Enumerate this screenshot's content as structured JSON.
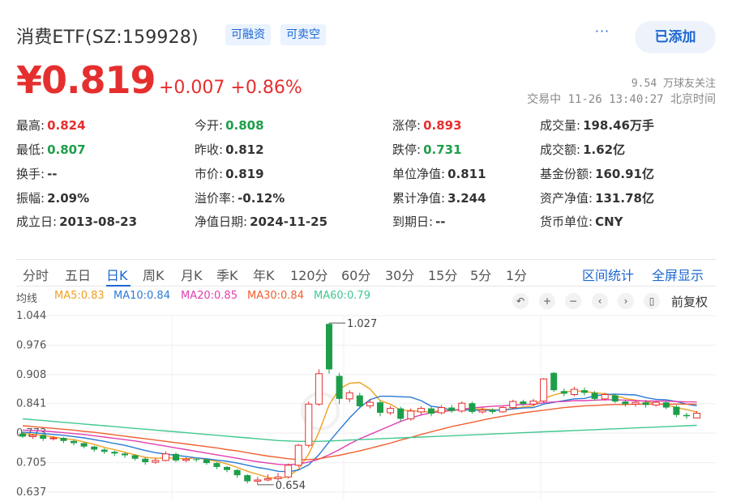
{
  "header": {
    "title": "消费ETF(SZ:159928)",
    "tags": [
      "可融资",
      "可卖空"
    ],
    "more": "···",
    "add_button": "已添加"
  },
  "price": {
    "current": "¥0.819",
    "change": "+0.007 +0.86%",
    "followers": "9.54 万球友关注",
    "status": "交易中 11-26 13:40:27 北京时间"
  },
  "quote": [
    [
      {
        "label": "最高:",
        "value": "0.824",
        "tone": "up"
      },
      {
        "label": "今开:",
        "value": "0.808",
        "tone": "down"
      },
      {
        "label": "涨停:",
        "value": "0.893",
        "tone": "up"
      },
      {
        "label": "成交量:",
        "value": "198.46万手",
        "tone": "neutral"
      }
    ],
    [
      {
        "label": "最低:",
        "value": "0.807",
        "tone": "down"
      },
      {
        "label": "昨收:",
        "value": "0.812",
        "tone": "neutral"
      },
      {
        "label": "跌停:",
        "value": "0.731",
        "tone": "down"
      },
      {
        "label": "成交额:",
        "value": "1.62亿",
        "tone": "neutral"
      }
    ],
    [
      {
        "label": "换手:",
        "value": "--",
        "tone": "neutral"
      },
      {
        "label": "市价:",
        "value": "0.819",
        "tone": "neutral"
      },
      {
        "label": "单位净值:",
        "value": "0.811",
        "tone": "neutral"
      },
      {
        "label": "基金份额:",
        "value": "160.91亿",
        "tone": "neutral"
      }
    ],
    [
      {
        "label": "振幅:",
        "value": "2.09%",
        "tone": "neutral"
      },
      {
        "label": "溢价率:",
        "value": "-0.12%",
        "tone": "neutral"
      },
      {
        "label": "累计净值:",
        "value": "3.244",
        "tone": "neutral"
      },
      {
        "label": "资产净值:",
        "value": "131.78亿",
        "tone": "neutral"
      }
    ],
    [
      {
        "label": "成立日:",
        "value": "2013-08-23",
        "tone": "neutral"
      },
      {
        "label": "净值日期:",
        "value": "2024-11-25",
        "tone": "neutral"
      },
      {
        "label": "到期日:",
        "value": "--",
        "tone": "neutral"
      },
      {
        "label": "货币单位:",
        "value": "CNY",
        "tone": "neutral"
      }
    ]
  ],
  "tabs": [
    "分时",
    "五日",
    "日K",
    "周K",
    "月K",
    "季K",
    "年K",
    "120分",
    "60分",
    "30分",
    "15分",
    "5分",
    "1分"
  ],
  "active_tab": "日K",
  "tab_actions": [
    "区间统计",
    "全屏显示"
  ],
  "ma_legend": [
    {
      "label": "均线",
      "color": "#555555"
    },
    {
      "label": "MA5:0.83",
      "color": "#f0a020"
    },
    {
      "label": "MA10:0.84",
      "color": "#2a7bd5"
    },
    {
      "label": "MA20:0.85",
      "color": "#e040b0"
    },
    {
      "label": "MA30:0.84",
      "color": "#f06030"
    },
    {
      "label": "MA60:0.79",
      "color": "#40c890"
    }
  ],
  "chart_controls": [
    "↶",
    "+",
    "−",
    "‹",
    "›",
    "▯"
  ],
  "fuquan": "前复权",
  "colors": {
    "up": "#e52f2f",
    "down": "#1e9e4a",
    "accent": "#1b66d2"
  },
  "chart_data": {
    "type": "candlestick",
    "y_ticks": [
      "1.044",
      "0.976",
      "0.908",
      "0.841",
      "0.773",
      "0.705",
      "0.637"
    ],
    "ylim": [
      0.637,
      1.044
    ],
    "annotations": [
      {
        "label": "1.027",
        "index": 30,
        "value": 1.027
      },
      {
        "label": "0.654",
        "index": 23,
        "value": 0.654
      }
    ],
    "candles": [
      {
        "o": 0.772,
        "c": 0.765,
        "h": 0.776,
        "l": 0.762
      },
      {
        "o": 0.765,
        "c": 0.768,
        "h": 0.771,
        "l": 0.76
      },
      {
        "o": 0.768,
        "c": 0.76,
        "h": 0.77,
        "l": 0.755
      },
      {
        "o": 0.76,
        "c": 0.762,
        "h": 0.766,
        "l": 0.756
      },
      {
        "o": 0.762,
        "c": 0.755,
        "h": 0.764,
        "l": 0.75
      },
      {
        "o": 0.755,
        "c": 0.75,
        "h": 0.758,
        "l": 0.745
      },
      {
        "o": 0.75,
        "c": 0.742,
        "h": 0.752,
        "l": 0.738
      },
      {
        "o": 0.742,
        "c": 0.735,
        "h": 0.744,
        "l": 0.73
      },
      {
        "o": 0.735,
        "c": 0.73,
        "h": 0.738,
        "l": 0.725
      },
      {
        "o": 0.73,
        "c": 0.726,
        "h": 0.733,
        "l": 0.72
      },
      {
        "o": 0.726,
        "c": 0.722,
        "h": 0.728,
        "l": 0.716
      },
      {
        "o": 0.722,
        "c": 0.714,
        "h": 0.724,
        "l": 0.71
      },
      {
        "o": 0.714,
        "c": 0.706,
        "h": 0.718,
        "l": 0.7
      },
      {
        "o": 0.706,
        "c": 0.71,
        "h": 0.716,
        "l": 0.702
      },
      {
        "o": 0.71,
        "c": 0.725,
        "h": 0.731,
        "l": 0.708
      },
      {
        "o": 0.725,
        "c": 0.71,
        "h": 0.728,
        "l": 0.706
      },
      {
        "o": 0.71,
        "c": 0.713,
        "h": 0.717,
        "l": 0.706
      },
      {
        "o": 0.713,
        "c": 0.712,
        "h": 0.716,
        "l": 0.707
      },
      {
        "o": 0.712,
        "c": 0.704,
        "h": 0.714,
        "l": 0.7
      },
      {
        "o": 0.704,
        "c": 0.695,
        "h": 0.706,
        "l": 0.69
      },
      {
        "o": 0.695,
        "c": 0.688,
        "h": 0.697,
        "l": 0.683
      },
      {
        "o": 0.688,
        "c": 0.676,
        "h": 0.69,
        "l": 0.67
      },
      {
        "o": 0.676,
        "c": 0.662,
        "h": 0.678,
        "l": 0.657
      },
      {
        "o": 0.662,
        "c": 0.665,
        "h": 0.672,
        "l": 0.654
      },
      {
        "o": 0.665,
        "c": 0.668,
        "h": 0.678,
        "l": 0.662
      },
      {
        "o": 0.668,
        "c": 0.672,
        "h": 0.681,
        "l": 0.664
      },
      {
        "o": 0.672,
        "c": 0.699,
        "h": 0.703,
        "l": 0.668
      },
      {
        "o": 0.699,
        "c": 0.745,
        "h": 0.748,
        "l": 0.695
      },
      {
        "o": 0.745,
        "c": 0.84,
        "h": 0.846,
        "l": 0.74
      },
      {
        "o": 0.84,
        "c": 0.91,
        "h": 0.92,
        "l": 0.836
      },
      {
        "o": 1.025,
        "c": 0.92,
        "h": 1.027,
        "l": 0.91
      },
      {
        "o": 0.905,
        "c": 0.852,
        "h": 0.912,
        "l": 0.84
      },
      {
        "o": 0.852,
        "c": 0.866,
        "h": 0.872,
        "l": 0.844
      },
      {
        "o": 0.86,
        "c": 0.835,
        "h": 0.866,
        "l": 0.83
      },
      {
        "o": 0.836,
        "c": 0.844,
        "h": 0.852,
        "l": 0.83
      },
      {
        "o": 0.844,
        "c": 0.82,
        "h": 0.848,
        "l": 0.812
      },
      {
        "o": 0.82,
        "c": 0.83,
        "h": 0.836,
        "l": 0.815
      },
      {
        "o": 0.83,
        "c": 0.806,
        "h": 0.834,
        "l": 0.8
      },
      {
        "o": 0.806,
        "c": 0.824,
        "h": 0.83,
        "l": 0.802
      },
      {
        "o": 0.822,
        "c": 0.83,
        "h": 0.835,
        "l": 0.815
      },
      {
        "o": 0.83,
        "c": 0.818,
        "h": 0.834,
        "l": 0.812
      },
      {
        "o": 0.82,
        "c": 0.832,
        "h": 0.838,
        "l": 0.816
      },
      {
        "o": 0.832,
        "c": 0.824,
        "h": 0.838,
        "l": 0.82
      },
      {
        "o": 0.824,
        "c": 0.842,
        "h": 0.846,
        "l": 0.82
      },
      {
        "o": 0.842,
        "c": 0.822,
        "h": 0.846,
        "l": 0.818
      },
      {
        "o": 0.822,
        "c": 0.826,
        "h": 0.832,
        "l": 0.818
      },
      {
        "o": 0.826,
        "c": 0.822,
        "h": 0.83,
        "l": 0.818
      },
      {
        "o": 0.822,
        "c": 0.832,
        "h": 0.836,
        "l": 0.82
      },
      {
        "o": 0.832,
        "c": 0.846,
        "h": 0.85,
        "l": 0.828
      },
      {
        "o": 0.846,
        "c": 0.84,
        "h": 0.85,
        "l": 0.836
      },
      {
        "o": 0.84,
        "c": 0.847,
        "h": 0.852,
        "l": 0.836
      },
      {
        "o": 0.847,
        "c": 0.898,
        "h": 0.9,
        "l": 0.844
      },
      {
        "o": 0.912,
        "c": 0.872,
        "h": 0.914,
        "l": 0.868
      },
      {
        "o": 0.87,
        "c": 0.864,
        "h": 0.876,
        "l": 0.858
      },
      {
        "o": 0.862,
        "c": 0.874,
        "h": 0.88,
        "l": 0.858
      },
      {
        "o": 0.872,
        "c": 0.866,
        "h": 0.878,
        "l": 0.86
      },
      {
        "o": 0.866,
        "c": 0.852,
        "h": 0.87,
        "l": 0.848
      },
      {
        "o": 0.852,
        "c": 0.862,
        "h": 0.866,
        "l": 0.848
      },
      {
        "o": 0.86,
        "c": 0.846,
        "h": 0.864,
        "l": 0.842
      },
      {
        "o": 0.846,
        "c": 0.84,
        "h": 0.85,
        "l": 0.834
      },
      {
        "o": 0.84,
        "c": 0.844,
        "h": 0.848,
        "l": 0.834
      },
      {
        "o": 0.844,
        "c": 0.838,
        "h": 0.85,
        "l": 0.832
      },
      {
        "o": 0.838,
        "c": 0.844,
        "h": 0.848,
        "l": 0.834
      },
      {
        "o": 0.844,
        "c": 0.832,
        "h": 0.846,
        "l": 0.828
      },
      {
        "o": 0.834,
        "c": 0.815,
        "h": 0.838,
        "l": 0.81
      },
      {
        "o": 0.815,
        "c": 0.812,
        "h": 0.82,
        "l": 0.806
      },
      {
        "o": 0.808,
        "c": 0.819,
        "h": 0.824,
        "l": 0.807
      }
    ],
    "ma_series": [
      {
        "name": "MA5",
        "color": "#f0a020",
        "values": [
          0.772,
          0.77,
          0.768,
          0.764,
          0.76,
          0.758,
          0.753,
          0.747,
          0.74,
          0.735,
          0.729,
          0.723,
          0.717,
          0.715,
          0.716,
          0.715,
          0.714,
          0.716,
          0.712,
          0.708,
          0.702,
          0.694,
          0.685,
          0.678,
          0.671,
          0.668,
          0.673,
          0.69,
          0.725,
          0.775,
          0.838,
          0.875,
          0.888,
          0.89,
          0.875,
          0.848,
          0.84,
          0.826,
          0.825,
          0.823,
          0.822,
          0.826,
          0.825,
          0.829,
          0.828,
          0.829,
          0.827,
          0.826,
          0.83,
          0.833,
          0.836,
          0.853,
          0.861,
          0.867,
          0.871,
          0.869,
          0.866,
          0.864,
          0.86,
          0.853,
          0.849,
          0.846,
          0.841,
          0.839,
          0.832,
          0.827,
          0.822
        ]
      },
      {
        "name": "MA10",
        "color": "#2a7bd5",
        "values": [
          0.775,
          0.774,
          0.772,
          0.77,
          0.768,
          0.765,
          0.762,
          0.758,
          0.754,
          0.749,
          0.745,
          0.739,
          0.733,
          0.728,
          0.725,
          0.722,
          0.719,
          0.716,
          0.714,
          0.711,
          0.708,
          0.704,
          0.699,
          0.694,
          0.69,
          0.685,
          0.684,
          0.688,
          0.7,
          0.723,
          0.753,
          0.781,
          0.808,
          0.832,
          0.85,
          0.858,
          0.858,
          0.857,
          0.856,
          0.848,
          0.835,
          0.832,
          0.826,
          0.827,
          0.826,
          0.826,
          0.826,
          0.826,
          0.829,
          0.831,
          0.832,
          0.84,
          0.844,
          0.848,
          0.852,
          0.853,
          0.859,
          0.862,
          0.863,
          0.862,
          0.861,
          0.855,
          0.851,
          0.85,
          0.846,
          0.84,
          0.836
        ]
      },
      {
        "name": "MA20",
        "color": "#e040b0",
        "values": [
          0.78,
          0.779,
          0.778,
          0.776,
          0.774,
          0.772,
          0.77,
          0.767,
          0.764,
          0.761,
          0.758,
          0.755,
          0.751,
          0.747,
          0.743,
          0.739,
          0.735,
          0.731,
          0.727,
          0.723,
          0.719,
          0.715,
          0.711,
          0.707,
          0.704,
          0.701,
          0.7,
          0.702,
          0.706,
          0.713,
          0.723,
          0.735,
          0.748,
          0.76,
          0.77,
          0.78,
          0.79,
          0.8,
          0.808,
          0.815,
          0.82,
          0.823,
          0.825,
          0.828,
          0.831,
          0.833,
          0.835,
          0.836,
          0.838,
          0.839,
          0.84,
          0.843,
          0.845,
          0.846,
          0.848,
          0.848,
          0.849,
          0.85,
          0.85,
          0.849,
          0.848,
          0.847,
          0.847,
          0.847,
          0.846,
          0.845,
          0.845
        ]
      },
      {
        "name": "MA30",
        "color": "#f06030",
        "values": [
          0.79,
          0.788,
          0.786,
          0.784,
          0.782,
          0.78,
          0.777,
          0.775,
          0.772,
          0.769,
          0.766,
          0.763,
          0.76,
          0.757,
          0.754,
          0.751,
          0.748,
          0.745,
          0.742,
          0.739,
          0.735,
          0.732,
          0.728,
          0.724,
          0.72,
          0.717,
          0.714,
          0.712,
          0.712,
          0.714,
          0.718,
          0.722,
          0.727,
          0.732,
          0.738,
          0.744,
          0.75,
          0.757,
          0.763,
          0.77,
          0.776,
          0.782,
          0.788,
          0.793,
          0.798,
          0.803,
          0.808,
          0.812,
          0.816,
          0.82,
          0.823,
          0.826,
          0.829,
          0.832,
          0.834,
          0.836,
          0.837,
          0.838,
          0.839,
          0.839,
          0.84,
          0.84,
          0.84,
          0.84,
          0.84,
          0.84,
          0.84
        ]
      },
      {
        "name": "MA60",
        "color": "#40c890",
        "values": [
          0.806,
          0.804,
          0.802,
          0.8,
          0.798,
          0.796,
          0.794,
          0.792,
          0.79,
          0.788,
          0.786,
          0.784,
          0.782,
          0.78,
          0.778,
          0.776,
          0.774,
          0.772,
          0.77,
          0.768,
          0.766,
          0.764,
          0.762,
          0.76,
          0.758,
          0.756,
          0.755,
          0.754,
          0.754,
          0.754,
          0.755,
          0.756,
          0.757,
          0.758,
          0.759,
          0.76,
          0.761,
          0.762,
          0.763,
          0.764,
          0.765,
          0.766,
          0.767,
          0.768,
          0.769,
          0.77,
          0.771,
          0.772,
          0.773,
          0.774,
          0.775,
          0.776,
          0.777,
          0.778,
          0.779,
          0.78,
          0.781,
          0.782,
          0.783,
          0.784,
          0.785,
          0.786,
          0.787,
          0.788,
          0.789,
          0.79,
          0.791
        ]
      }
    ]
  }
}
